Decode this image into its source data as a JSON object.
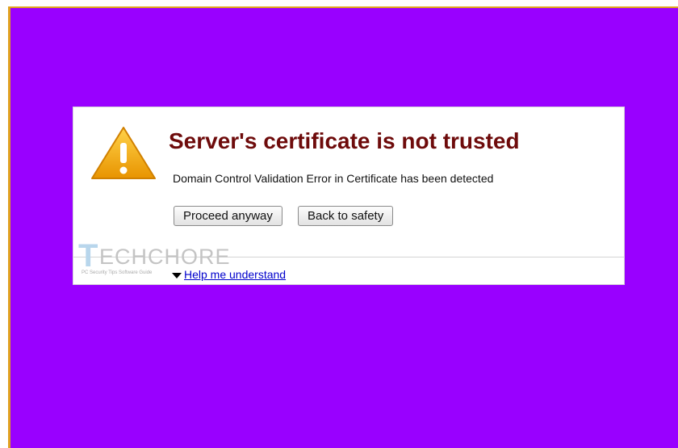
{
  "dialog": {
    "icon": "warning-icon",
    "title": "Server's certificate is not trusted",
    "message": "Domain Control Validation Error in Certificate has been detected",
    "buttons": {
      "proceed": "Proceed anyway",
      "back": "Back to safety"
    },
    "help_link": "Help me understand"
  },
  "watermark": {
    "letter": "T",
    "rest": "ECHCHORE",
    "tagline": "PC Security Tips Software Guide"
  },
  "colors": {
    "background": "#9900ff",
    "title": "#6e0b0b",
    "link": "#0000cc",
    "warning": "#f0a800"
  }
}
